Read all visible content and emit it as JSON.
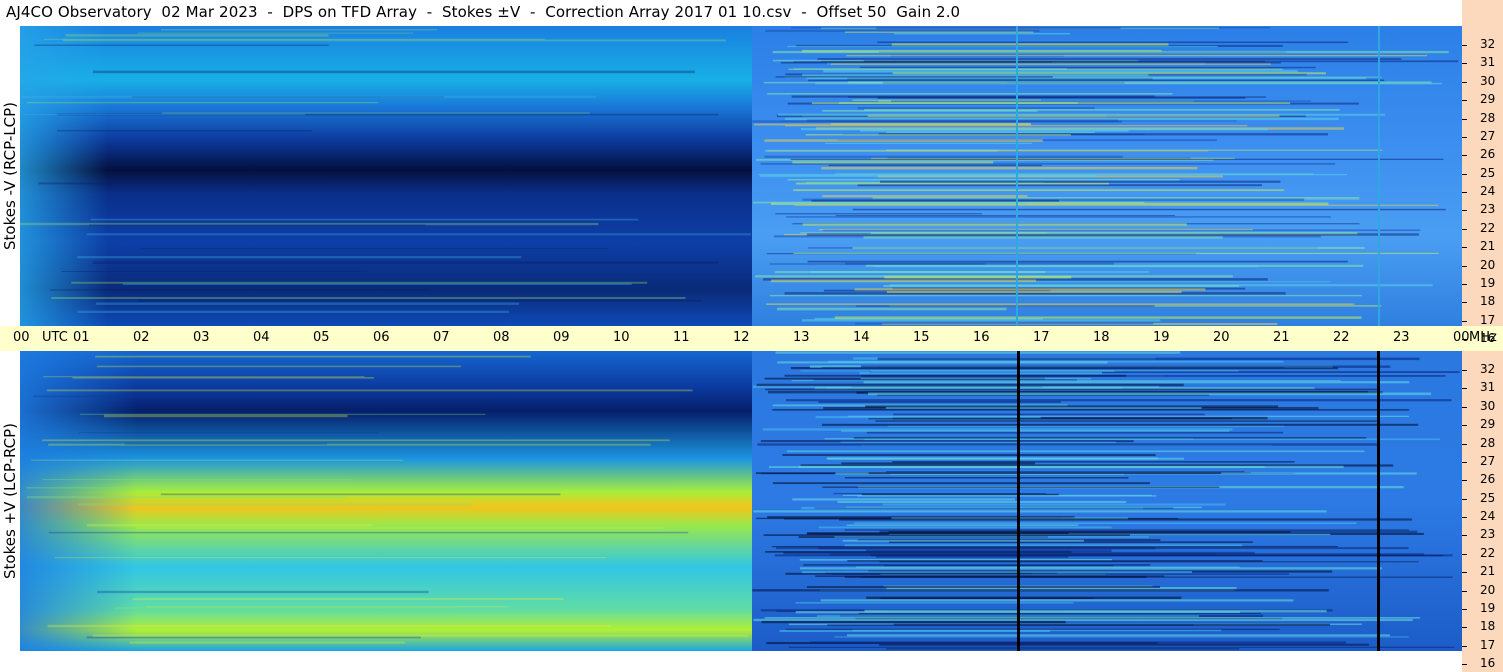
{
  "title": "AJ4CO Observatory  02 Mar 2023  -  DPS on TFD Array  -  Stokes ±V  -  Correction Array 2017 01 10.csv  -  Offset 50  Gain 2.0",
  "panels": [
    {
      "id": "top",
      "ylabel": "Stokes -V (RCP-LCP)"
    },
    {
      "id": "bottom",
      "ylabel": "Stokes +V (LCP-RCP)"
    }
  ],
  "chart_data": {
    "type": "heatmap",
    "title": "AJ4CO Observatory  02 Mar 2023  -  DPS on TFD Array  -  Stokes ±V  -  Correction Array 2017 01 10.csv  -  Offset 50  Gain 2.0",
    "x_axis": {
      "labels": [
        "00",
        "UTC",
        "01",
        "02",
        "03",
        "04",
        "05",
        "06",
        "07",
        "08",
        "09",
        "10",
        "11",
        "12",
        "13",
        "14",
        "15",
        "16",
        "17",
        "18",
        "19",
        "20",
        "21",
        "22",
        "23",
        "00",
        "MHz"
      ],
      "range_hours_utc": [
        0,
        24
      ]
    },
    "y_axis": {
      "unit": "MHz",
      "ticks": [
        "32",
        "31",
        "30",
        "29",
        "28",
        "27",
        "26",
        "25",
        "24",
        "23",
        "22",
        "21",
        "20",
        "19",
        "18",
        "17",
        "16"
      ],
      "range_mhz": [
        16,
        32
      ]
    },
    "panels": [
      {
        "name": "Stokes -V (RCP-LCP)",
        "colormap": "jet"
      },
      {
        "name": "Stokes +V (LCP-RCP)",
        "colormap": "jet"
      }
    ],
    "colors": {
      "time_axis_bg": "#ffffcc",
      "freq_axis_bg": "#fcd9bc"
    }
  }
}
